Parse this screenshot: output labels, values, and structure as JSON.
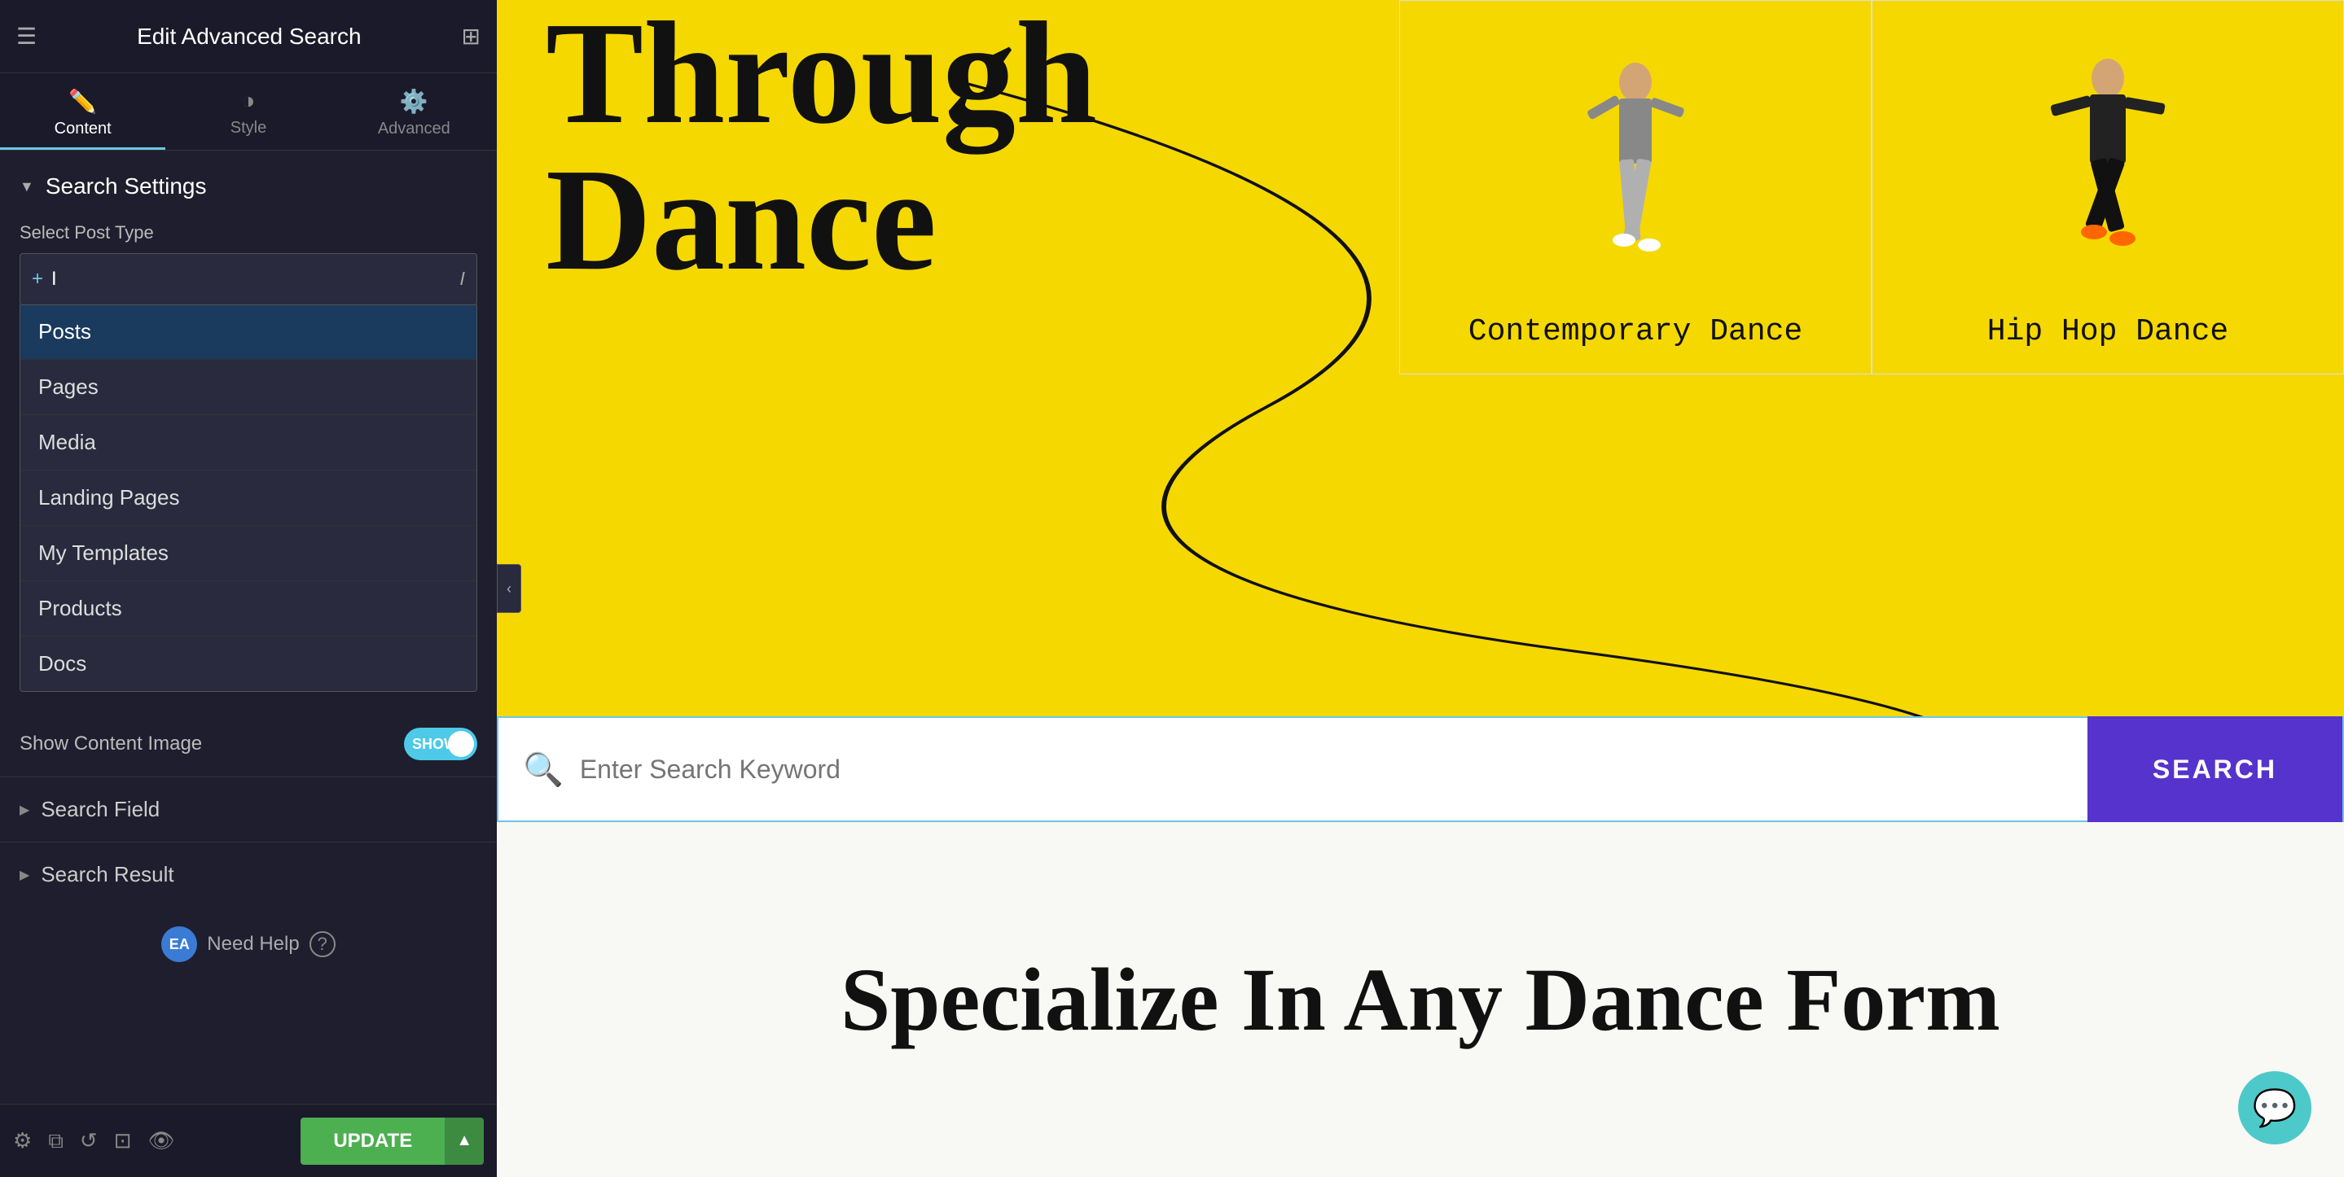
{
  "topBar": {
    "title": "Edit Advanced Search",
    "hamburgerLabel": "☰",
    "gridLabel": "⊞"
  },
  "tabs": [
    {
      "id": "content",
      "icon": "✏️",
      "label": "Content",
      "active": true
    },
    {
      "id": "style",
      "icon": "◑",
      "label": "Style",
      "active": false
    },
    {
      "id": "advanced",
      "icon": "⚙️",
      "label": "Advanced",
      "active": false
    }
  ],
  "searchSettings": {
    "sectionTitle": "Search Settings",
    "postTypeLabel": "Select Post Type",
    "inputPlaceholder": "I",
    "dropdownItems": [
      {
        "id": "posts",
        "label": "Posts",
        "highlighted": true
      },
      {
        "id": "pages",
        "label": "Pages"
      },
      {
        "id": "media",
        "label": "Media"
      },
      {
        "id": "landing-pages",
        "label": "Landing Pages"
      },
      {
        "id": "my-templates",
        "label": "My Templates"
      },
      {
        "id": "products",
        "label": "Products"
      },
      {
        "id": "docs",
        "label": "Docs"
      }
    ],
    "toggleLabel": "Show Content Image",
    "toggleValue": "SHOW"
  },
  "searchField": {
    "sectionTitle": "Search Field"
  },
  "searchResult": {
    "sectionTitle": "Search Result"
  },
  "helpSection": {
    "badge": "EA",
    "helpText": "Need Help",
    "helpIcon": "?"
  },
  "bottomBar": {
    "updateLabel": "UPDATE",
    "dropdownIcon": "▲"
  },
  "mainContent": {
    "heroTitle": "Through\nDance",
    "danceCards": [
      {
        "id": "contemporary",
        "label": "Contemporary Dance"
      },
      {
        "id": "hiphop",
        "label": "Hip Hop Dance"
      }
    ],
    "searchBar": {
      "placeholder": "Enter Search Keyword",
      "buttonLabel": "SEARCH"
    },
    "lowerTitle": "Specialize In Any Dance Form"
  },
  "chatBubble": {
    "icon": "💬"
  }
}
